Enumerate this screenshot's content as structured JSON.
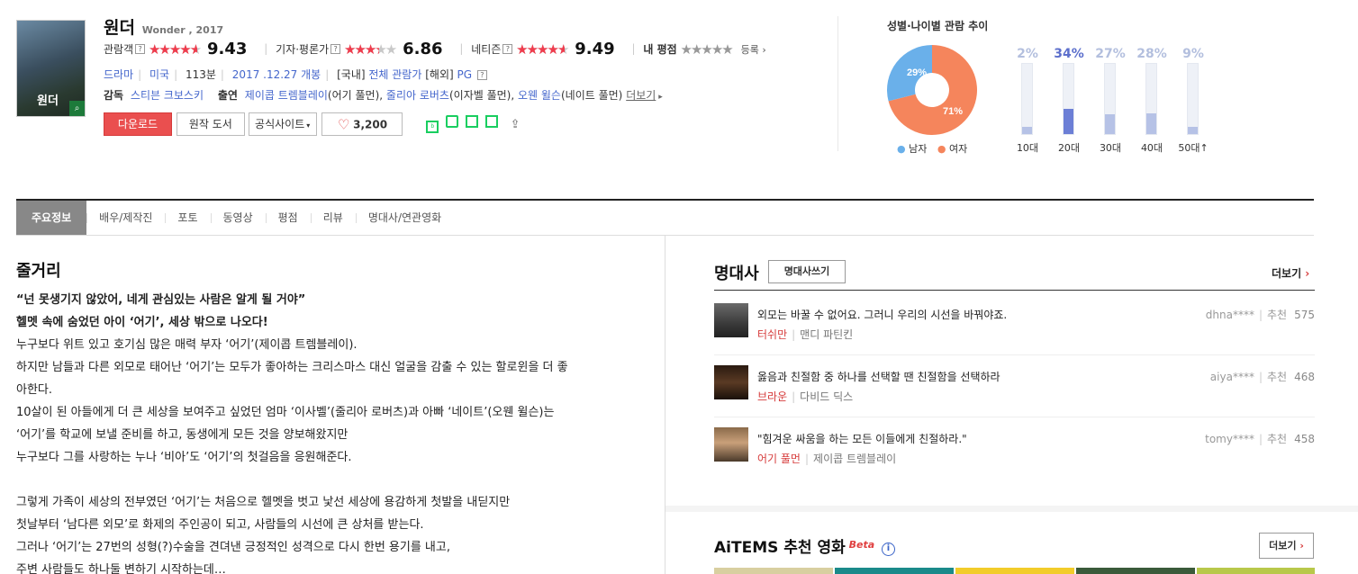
{
  "movie": {
    "title": "원더",
    "subtitle": "Wonder , 2017",
    "poster_text": "원더",
    "ratings": [
      {
        "label": "관람객",
        "score": "9.43",
        "fraction": 0.943
      },
      {
        "label": "기자·평론가",
        "score": "6.86",
        "fraction": 0.686
      },
      {
        "label": "네티즌",
        "score": "9.49",
        "fraction": 0.949
      }
    ],
    "my_rating_label": "내 평점",
    "register_label": "등록",
    "info": {
      "genre": "드라마",
      "country": "미국",
      "runtime": "113분",
      "release": "2017 .12.27 개봉",
      "domestic_label": "[국내]",
      "domestic_rating": "전체 관람가",
      "overseas_label": "[해외]",
      "overseas_rating": "PG"
    },
    "director_label": "감독",
    "director": "스티븐 크보스키",
    "cast_label": "출연",
    "cast": [
      {
        "name": "제이콥 트렘블레이",
        "role": "(어기 풀먼)"
      },
      {
        "name": "줄리아 로버츠",
        "role": "(이자벨 풀먼)"
      },
      {
        "name": "오웬 윌슨",
        "role": "(네이트 풀먼)"
      }
    ],
    "more_label": "더보기",
    "buttons": {
      "download": "다운로드",
      "book": "원작 도서",
      "official": "공식사이트",
      "like_count": "3,200"
    }
  },
  "demographics": {
    "title": "성별·나이별 관람 추이",
    "male_pct": "29%",
    "female_pct": "71%",
    "male_frac": 0.29,
    "male_label": "남자",
    "female_label": "여자",
    "male_color": "#6ab0ea",
    "female_color": "#f5855c",
    "ages": [
      {
        "label": "10대",
        "pct": "2%",
        "value": 0.02
      },
      {
        "label": "20대",
        "pct": "34%",
        "value": 0.34
      },
      {
        "label": "30대",
        "pct": "27%",
        "value": 0.27
      },
      {
        "label": "40대",
        "pct": "28%",
        "value": 0.28
      },
      {
        "label": "50대↑",
        "pct": "9%",
        "value": 0.09
      }
    ]
  },
  "tabs": [
    "주요정보",
    "배우/제작진",
    "포토",
    "동영상",
    "평점",
    "리뷰",
    "명대사/연관영화"
  ],
  "plot": {
    "heading": "줄거리",
    "tagline1": "“넌 못생기지 않았어, 네게 관심있는 사람은 알게 될 거야”",
    "tagline2": "헬멧 속에 숨었던 아이 ‘어기’, 세상 밖으로 나오다!",
    "lines": [
      "누구보다 위트 있고 호기심 많은 매력 부자 ‘어기’(제이콥 트렘블레이).",
      " 하지만 남들과 다른 외모로 태어난 ‘어기’는 모두가 좋아하는 크리스마스 대신 얼굴을 감출 수 있는 할로윈을 더 좋",
      "아한다.",
      " 10살이 된 아들에게 더 큰 세상을 보여주고 싶었던 엄마 ‘이사벨’(줄리아 로버츠)과 아빠 ‘네이트’(오웬 윌슨)는",
      " ‘어기’를 학교에 보낼 준비를 하고, 동생에게 모든 것을 양보해왔지만",
      " 누구보다 그를 사랑하는 누나 ‘비아’도 ‘어기’의 첫걸음을 응원해준다.",
      "",
      " 그렇게 가족이 세상의 전부였던 ‘어기’는 처음으로 헬멧을 벗고 낯선 세상에 용감하게 첫발을 내딛지만",
      " 첫날부터 ‘남다른 외모’로 화제의 주인공이 되고, 사람들의 시선에 큰 상처를 받는다.",
      " 그러나 ‘어기’는 27번의 성형(?)수술을 견뎌낸 긍정적인 성격으로 다시 한번 용기를 내고,",
      " 주변 사람들도 하나둘 변하기 시작하는데…"
    ]
  },
  "quotes": {
    "heading": "명대사",
    "write_label": "명대사쓰기",
    "more_label": "더보기",
    "recommend_label": "추천",
    "items": [
      {
        "text": "외모는 바꿀 수 없어요. 그러니 우리의 시선을 바꿔야죠.",
        "character": "터쉬만",
        "actor": "맨디 파틴킨",
        "user": "dhna****",
        "count": "575"
      },
      {
        "text": "옳음과 친절함 중 하나를 선택할 땐 친절함을 선택하라",
        "character": "브라운",
        "actor": "다비드 딕스",
        "user": "aiya****",
        "count": "468"
      },
      {
        "text": "\"힘겨운 싸움을 하는 모든 이들에게 친절하라.\"",
        "character": "어기 풀먼",
        "actor": "제이콥 트렘블레이",
        "user": "tomy****",
        "count": "458"
      }
    ]
  },
  "aitems": {
    "heading": "AiTEMS 추천 영화",
    "beta": "Beta",
    "more_label": "더보기"
  }
}
